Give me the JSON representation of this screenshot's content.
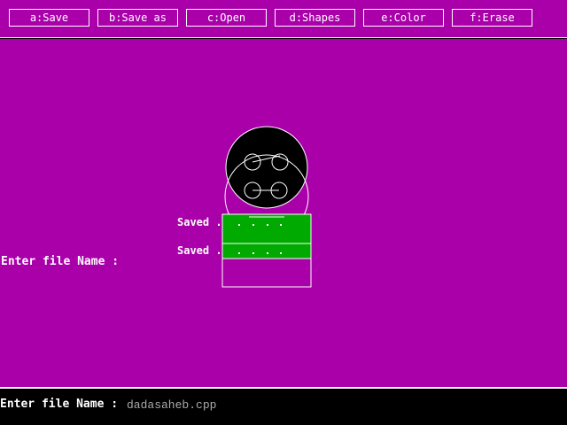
{
  "menu": {
    "items": [
      {
        "id": "save",
        "label": "a:Save"
      },
      {
        "id": "save-as",
        "label": "b:Save as"
      },
      {
        "id": "open",
        "label": "c:Open"
      },
      {
        "id": "shapes",
        "label": "d:Shapes"
      },
      {
        "id": "color",
        "label": "e:Color"
      },
      {
        "id": "erase",
        "label": "f:Erase"
      }
    ]
  },
  "canvas": {
    "background": "#aa00aa",
    "saved_label_1": "Saved .",
    "saved_label_2": "Saved .",
    "prompt_text": "Enter file Name :",
    "green_fill": "#00aa00"
  },
  "status": {
    "prompt": "Enter file Name :",
    "filename": "dadasaheb.cpp"
  }
}
